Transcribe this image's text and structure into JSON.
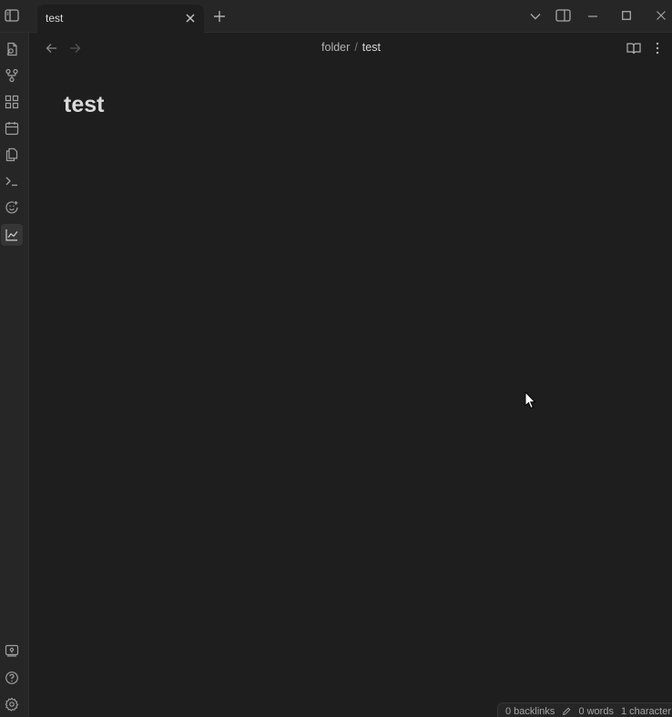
{
  "tab": {
    "title": "test"
  },
  "breadcrumb": {
    "folder": "folder",
    "separator": "/",
    "current": "test"
  },
  "note": {
    "title": "test"
  },
  "status": {
    "backlinks": "0 backlinks",
    "words": "0 words",
    "characters": "1 character"
  }
}
